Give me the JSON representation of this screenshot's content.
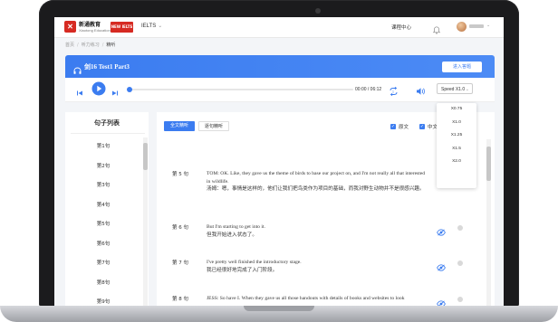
{
  "header": {
    "logo_cn": "新通教育",
    "logo_en": "Xiaotong Education",
    "badge": "NEW IELTS",
    "exam_selector": "IELTS",
    "course_center": "课程中心"
  },
  "breadcrumb": [
    "首页",
    "听力练习",
    "精听"
  ],
  "lesson": {
    "title": "剑16 Test1 Part3",
    "enter_button": "进入答题"
  },
  "player": {
    "time": "00:00 / 06:12",
    "speed": "Speed X1.0",
    "progress": 0.0
  },
  "speed_options": [
    "X0.75",
    "X1.0",
    "X1.25",
    "X1.5",
    "X2.0"
  ],
  "sidebar": {
    "title": "句子列表",
    "items": [
      "第1句",
      "第2句",
      "第3句",
      "第4句",
      "第5句",
      "第6句",
      "第7句",
      "第8句",
      "第9句"
    ]
  },
  "tabs": [
    "全文精听",
    "逐句精听"
  ],
  "filters": {
    "original": "原文",
    "chinese": "中文"
  },
  "sentences": [
    {
      "num": "第 5 句",
      "en": "TOM: OK. Like, they gave us the theme of birds to base our project on, and I'm not really all that interested in wildlife.",
      "cn": "汤姆：嗯，事情是这样的，他们让我们把鸟类作为项目的基础，而我对野生动物并不是很感兴趣。"
    },
    {
      "num": "第 6 句",
      "en": "But I'm starting to get into it.",
      "cn": "但我开始进入状态了。"
    },
    {
      "num": "第 7 句",
      "en": "I've pretty well finished the introductory stage.",
      "cn": "我已经很好地完成了入门阶段。"
    },
    {
      "num": "第 8 句",
      "en": "JESS: So have I. When they gave us all those handouts with details of books and websites to look",
      "cn": ""
    }
  ],
  "colors": {
    "accent": "#3b7cf0",
    "brand_red": "#d62a22"
  }
}
